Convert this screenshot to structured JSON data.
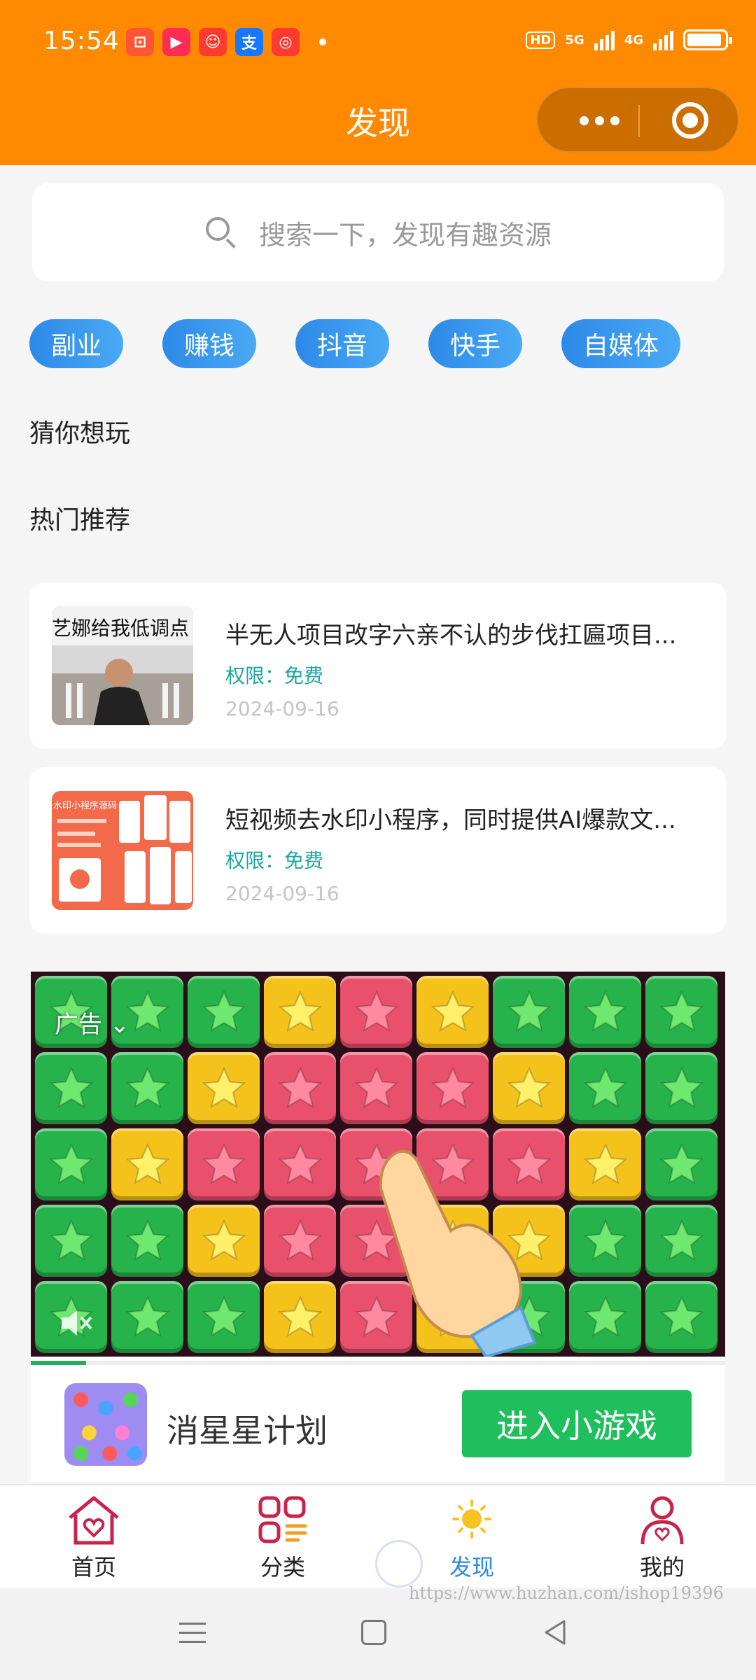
{
  "status_bar": {
    "time": "15:54",
    "apps": [
      {
        "name": "app-icon-1",
        "color": "#ff5533",
        "glyph": "⊡"
      },
      {
        "name": "app-icon-2",
        "color": "#ff2d55",
        "glyph": "▶"
      },
      {
        "name": "app-icon-3",
        "color": "#ff3b30",
        "glyph": "☺"
      },
      {
        "name": "alipay-icon",
        "color": "#1677ff",
        "glyph": "支"
      },
      {
        "name": "app-icon-5",
        "color": "#ff3b30",
        "glyph": "◎"
      }
    ],
    "hd_label": "HD",
    "network_1": "5G",
    "network_2": "4G"
  },
  "header": {
    "title": "发现",
    "bg_color": "#ff8a00"
  },
  "search": {
    "placeholder": "搜索一下，发现有趣资源"
  },
  "tags": [
    "副业",
    "赚钱",
    "抖音",
    "快手",
    "自媒体"
  ],
  "sections": {
    "guess": "猜你想玩",
    "hot": "热门推荐"
  },
  "articles": [
    {
      "title": "半无人项目改字六亲不认的步伐扛匾项目...",
      "permission": "权限：免费",
      "date": "2024-09-16",
      "thumb_text": "艺娜给我低调点"
    },
    {
      "title": "短视频去水印小程序，同时提供AI爆款文...",
      "permission": "权限：免费",
      "date": "2024-09-16",
      "thumb_text": "水印小程序源码"
    }
  ],
  "ad": {
    "label": "广告",
    "app_name": "消星星计划",
    "cta": "进入小游戏",
    "progress": 0.08,
    "board": [
      [
        "g",
        "g",
        "g",
        "y",
        "r",
        "y",
        "g",
        "g",
        "g"
      ],
      [
        "g",
        "g",
        "y",
        "r",
        "r",
        "r",
        "y",
        "g",
        "g"
      ],
      [
        "g",
        "y",
        "r",
        "r",
        "r",
        "r",
        "r",
        "y",
        "g"
      ],
      [
        "g",
        "g",
        "y",
        "r",
        "r",
        "y",
        "y",
        "g",
        "g"
      ],
      [
        "g",
        "g",
        "g",
        "y",
        "r",
        "y",
        "g",
        "g",
        "g"
      ]
    ]
  },
  "tabbar": {
    "items": [
      {
        "label": "首页",
        "icon": "home-heart-icon"
      },
      {
        "label": "分类",
        "icon": "category-grid-icon"
      },
      {
        "label": "发现",
        "icon": "sun-icon",
        "active": true
      },
      {
        "label": "我的",
        "icon": "user-heart-icon"
      }
    ],
    "active_color": "#2b8ae2"
  },
  "watermark": "https://www.huzhan.com/ishop19396"
}
